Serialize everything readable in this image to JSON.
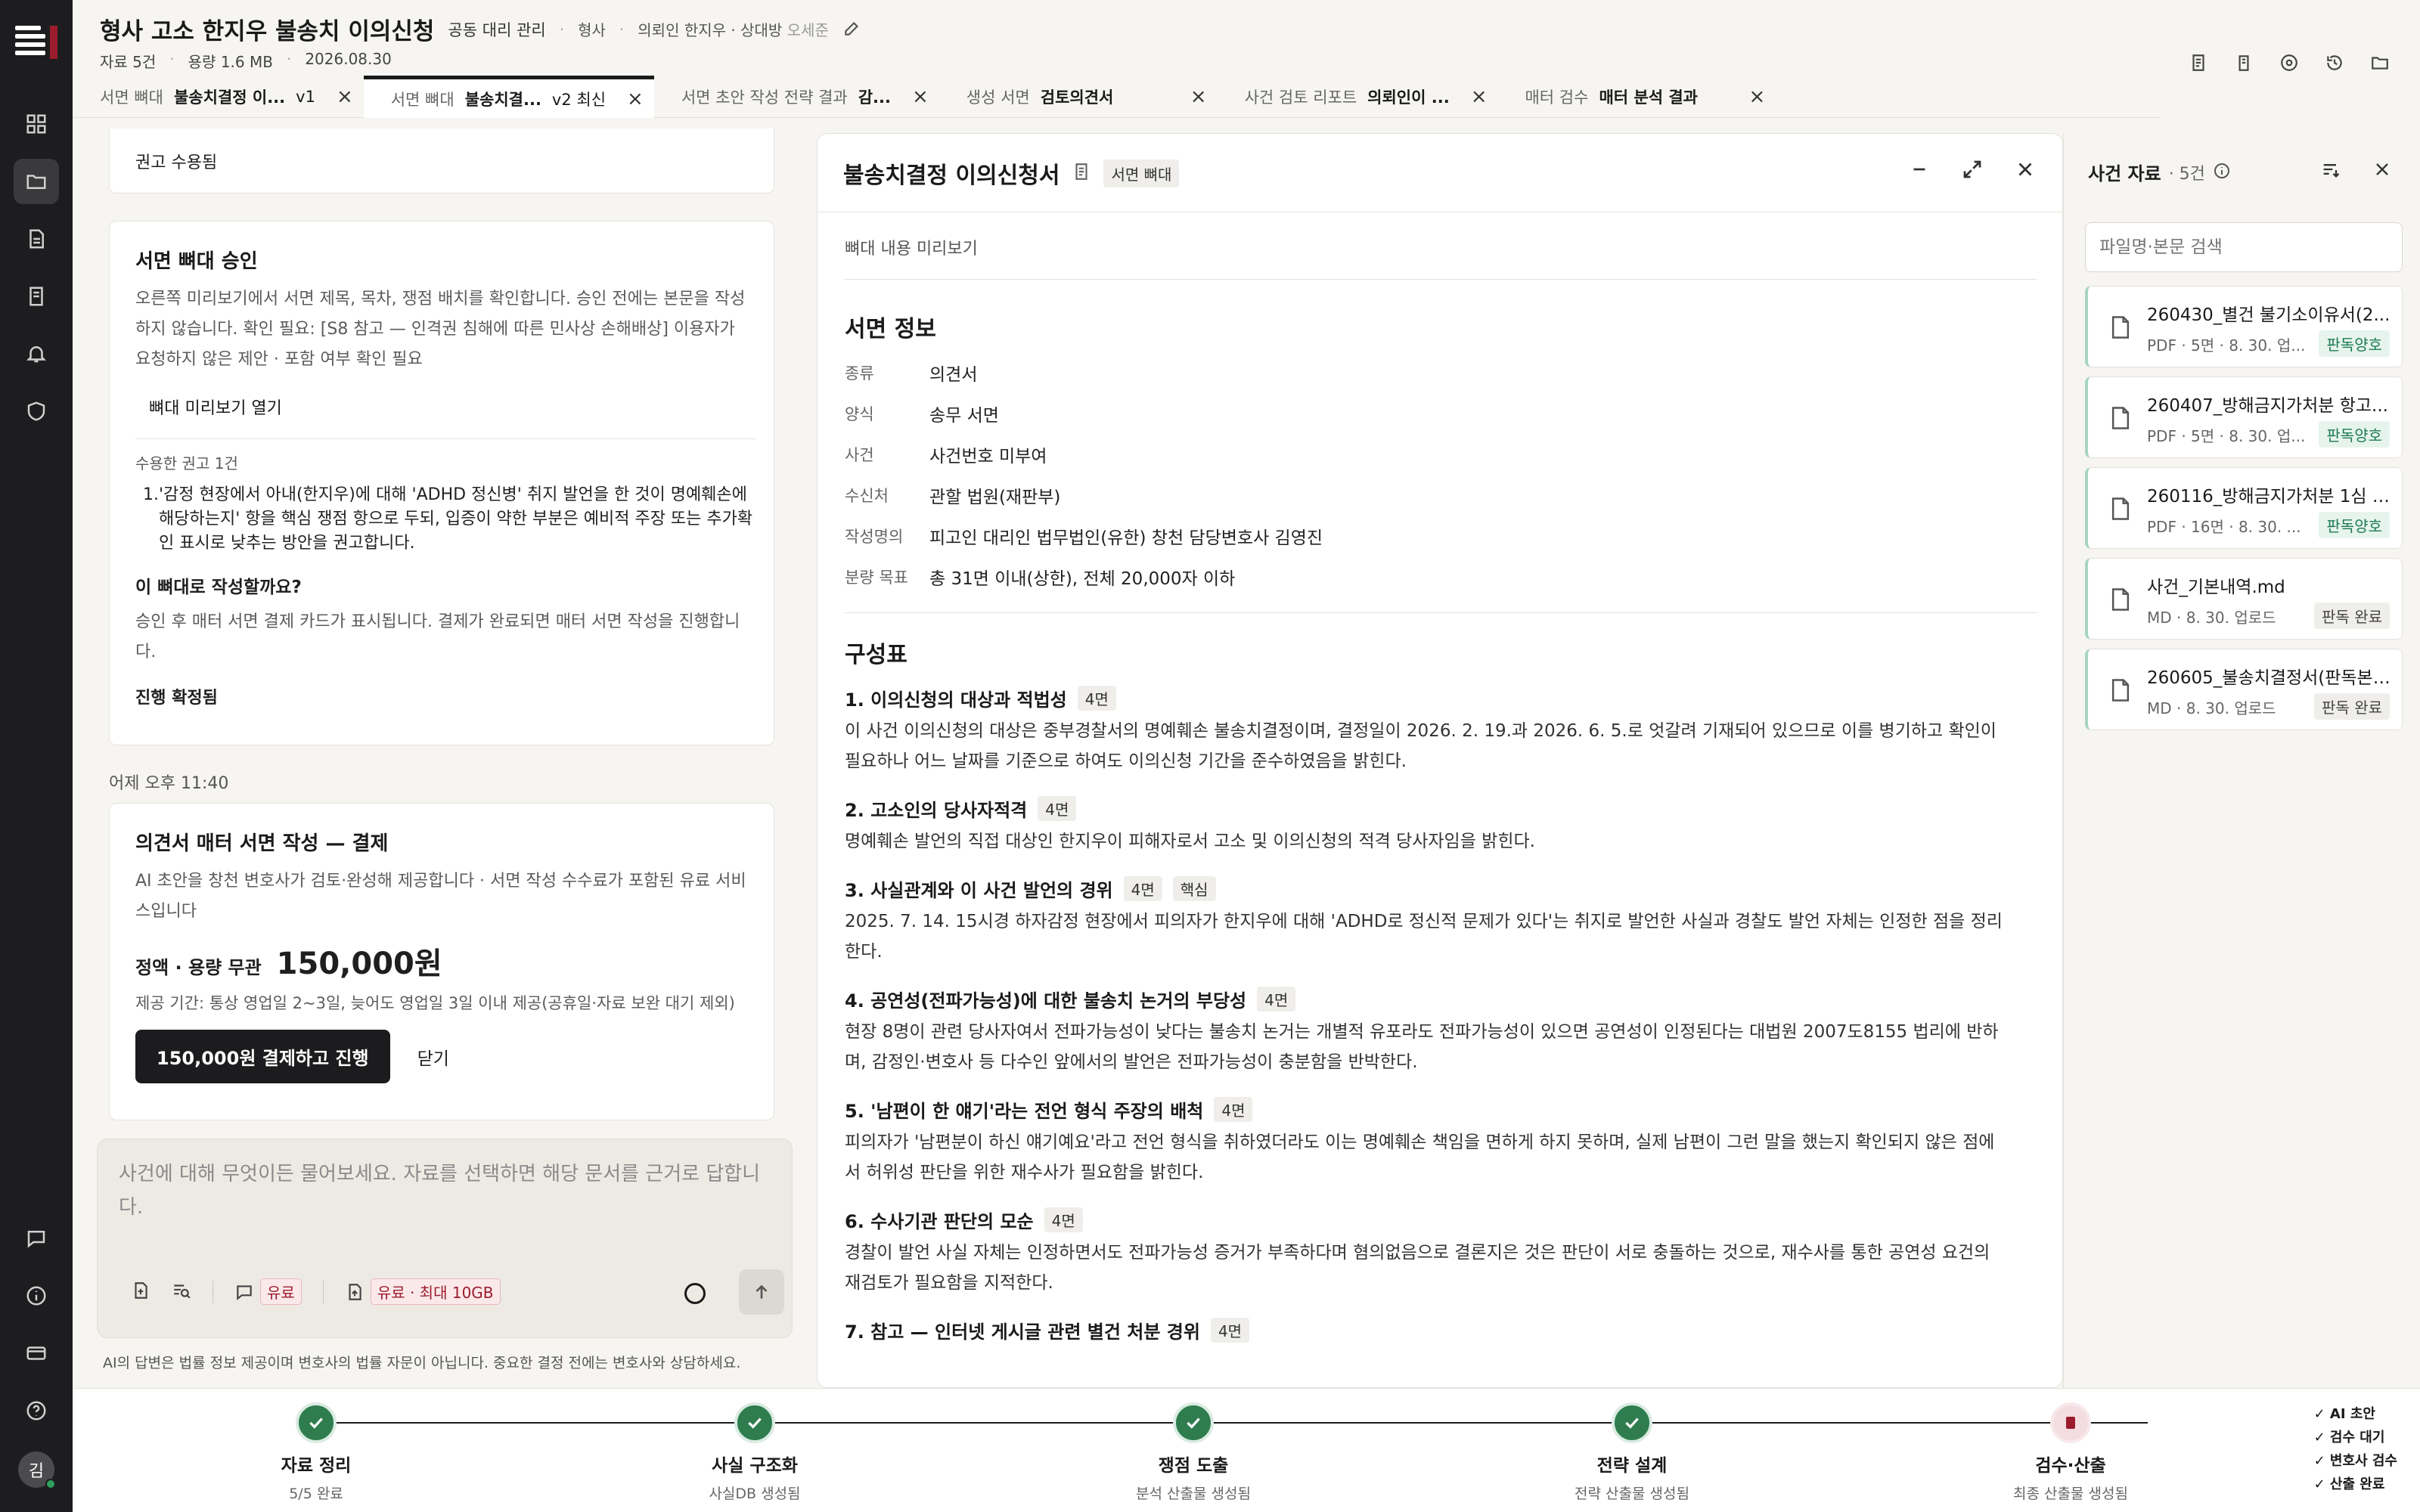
{
  "header": {
    "title": "형사 고소 한지우 불송치 이의신청",
    "badge": "공동 대리 관리",
    "category": "형사",
    "client_label": "의뢰인 한지우 · 상대방",
    "opponent": "오세준",
    "files_count": "자료 5건",
    "size": "용량 1.6 MB",
    "date": "2026.08.30"
  },
  "tabs": [
    {
      "kind": "서면 뼈대",
      "name": "불송치결정 이...",
      "ver": "v1"
    },
    {
      "kind": "서면 뼈대",
      "name": "불송치결...",
      "ver": "v2 최신"
    },
    {
      "kind": "서면 초안 작성 전략 결과",
      "name": "감...",
      "ver": ""
    },
    {
      "kind": "생성 서면",
      "name": "검토의견서",
      "ver": ""
    },
    {
      "kind": "사건 검토 리포트",
      "name": "의뢰인이 ...",
      "ver": ""
    },
    {
      "kind": "매터 검수",
      "name": "매터 분석 결과",
      "ver": ""
    }
  ],
  "chat": {
    "accepted_note": "권고 수용됨",
    "skeleton_card": {
      "title": "서면 뼈대 승인",
      "desc": "오른쪽 미리보기에서 서면 제목, 목차, 쟁점 배치를 확인합니다. 승인 전에는 본문을 작성하지 않습니다. 확인 필요: [S8 참고 — 인격권 침해에 따른 민사상 손해배상] 이용자가 요청하지 않은 제안 · 포함 여부 확인 필요",
      "open_btn": "뼈대 미리보기 열기",
      "accepted_label": "수용한 권고 1건",
      "recommendation": "'감정 현장에서 아내(한지우)에 대해 'ADHD 정신병' 취지 발언을 한 것이 명예훼손에 해당하는지' 항을 핵심 쟁점 항으로 두되, 입증이 약한 부분은 예비적 주장 또는 추가확인 표시로 낮추는 방안을 권고합니다.",
      "question": "이 뼈대로 작성할까요?",
      "question_desc": "승인 후 매터 서면 결제 카드가 표시됩니다. 결제가 완료되면 매터 서면 작성을 진행합니다.",
      "confirmed": "진행 확정됨"
    },
    "timestamp": "어제 오후 11:40",
    "pay_card": {
      "title": "의견서 매터 서면 작성 — 결제",
      "desc": "AI 초안을 창천 변호사가 검토·완성해 제공합니다 · 서면 작성 수수료가 포함된 유료 서비스입니다",
      "price_label": "정액 · 용량 무관",
      "price": "150,000원",
      "period": "제공 기간: 통상 영업일 2~3일, 늦어도 영업일 3일 이내 제공(공휴일·자료 보완 대기 제외)",
      "pay_btn": "150,000원 결제하고 진행",
      "close_btn": "닫기"
    },
    "composer": {
      "placeholder": "사건에 대해 무엇이든 물어보세요. 자료를 선택하면 해당 문서를 근거로 답합니다.",
      "paid_badge": "유료",
      "paid_limit_badge": "유료 · 최대 10GB"
    },
    "disclaimer": "AI의 답변은 법률 정보 제공이며 변호사의 법률 자문이 아닙니다. 중요한 결정 전에는 변호사와 상담하세요."
  },
  "preview": {
    "title": "불송치결정 이의신청서",
    "chip": "서면 뼈대",
    "subtitle": "뼈대 내용 미리보기",
    "info_title": "서면 정보",
    "info": [
      {
        "k": "종류",
        "v": "의견서"
      },
      {
        "k": "양식",
        "v": "송무 서면"
      },
      {
        "k": "사건",
        "v": "사건번호 미부여"
      },
      {
        "k": "수신처",
        "v": "관할 법원(재판부)"
      },
      {
        "k": "작성명의",
        "v": "피고인 대리인 법무법인(유한) 창천 담당변호사 김영진"
      },
      {
        "k": "분량 목표",
        "v": "총 31면 이내(상한), 전체 20,000자 이하"
      }
    ],
    "outline_title": "구성표",
    "outline": [
      {
        "h": "1. 이의신청의 대상과 적법성",
        "p": "4면",
        "tag": "",
        "body": "이 사건 이의신청의 대상은 중부경찰서의 명예훼손 불송치결정이며, 결정일이 2026. 2. 19.과 2026. 6. 5.로 엇갈려 기재되어 있으므로 이를 병기하고 확인이 필요하나 어느 날짜를 기준으로 하여도 이의신청 기간을 준수하였음을 밝힌다."
      },
      {
        "h": "2. 고소인의 당사자적격",
        "p": "4면",
        "tag": "",
        "body": "명예훼손 발언의 직접 대상인 한지우이 피해자로서 고소 및 이의신청의 적격 당사자임을 밝힌다."
      },
      {
        "h": "3. 사실관계와 이 사건 발언의 경위",
        "p": "4면",
        "tag": "핵심",
        "body": "2025. 7. 14. 15시경 하자감정 현장에서 피의자가 한지우에 대해 'ADHD로 정신적 문제가 있다'는 취지로 발언한 사실과 경찰도 발언 자체는 인정한 점을 정리한다."
      },
      {
        "h": "4. 공연성(전파가능성)에 대한 불송치 논거의 부당성",
        "p": "4면",
        "tag": "",
        "body": "현장 8명이 관련 당사자여서 전파가능성이 낮다는 불송치 논거는 개별적 유포라도 전파가능성이 있으면 공연성이 인정된다는 대법원 2007도8155 법리에 반하며, 감정인·변호사 등 다수인 앞에서의 발언은 전파가능성이 충분함을 반박한다."
      },
      {
        "h": "5. '남편이 한 얘기'라는 전언 형식 주장의 배척",
        "p": "4면",
        "tag": "",
        "body": "피의자가 '남편분이 하신 얘기예요'라고 전언 형식을 취하였더라도 이는 명예훼손 책임을 면하게 하지 못하며, 실제 남편이 그런 말을 했는지 확인되지 않은 점에서 허위성 판단을 위한 재수사가 필요함을 밝힌다."
      },
      {
        "h": "6. 수사기관 판단의 모순",
        "p": "4면",
        "tag": "",
        "body": "경찰이 발언 사실 자체는 인정하면서도 전파가능성 증거가 부족하다며 혐의없음으로 결론지은 것은 판단이 서로 충돌하는 것으로, 재수사를 통한 공연성 요건의 재검토가 필요함을 지적한다."
      },
      {
        "h": "7. 참고 — 인터넷 게시글 관련 별건 처분 경위",
        "p": "4면",
        "tag": "",
        "body": ""
      }
    ]
  },
  "sidebar": {
    "title": "사건 자료",
    "count": "· 5건",
    "search_placeholder": "파일명·본문 검색",
    "files": [
      {
        "name": "260430_별건 불기소이유서(2...",
        "meta": "PDF · 5면 · 8. 30. 업...",
        "status": "판독양호"
      },
      {
        "name": "260407_방해금지가처분 항고...",
        "meta": "PDF · 5면 · 8. 30. 업...",
        "status": "판독양호"
      },
      {
        "name": "260116_방해금지가처분 1심 기...",
        "meta": "PDF · 16면 · 8. 30. ...",
        "status": "판독양호"
      },
      {
        "name": "사건_기본내역.md",
        "meta": "MD · 8. 30. 업로드",
        "status": "판독 완료"
      },
      {
        "name": "260605_불송치결정서(판독본)...",
        "meta": "MD · 8. 30. 업로드",
        "status": "판독 완료"
      }
    ]
  },
  "progress": {
    "steps": [
      {
        "name": "자료 정리",
        "sub": "5/5 완료"
      },
      {
        "name": "사실 구조화",
        "sub": "사실DB 생성됨"
      },
      {
        "name": "쟁점 도출",
        "sub": "분석 산출물 생성됨"
      },
      {
        "name": "전략 설계",
        "sub": "전략 산출물 생성됨"
      },
      {
        "name": "검수·산출",
        "sub": "최종 산출물 생성됨"
      }
    ],
    "legend": [
      "AI 초안",
      "검수 대기",
      "변호사 검수",
      "산출 완료"
    ]
  },
  "user": {
    "avatar_initial": "김"
  },
  "colors": {
    "accent_dark": "#1c1c1e",
    "brand_red": "#9b1c2c",
    "success_green": "#2f7d4f"
  }
}
